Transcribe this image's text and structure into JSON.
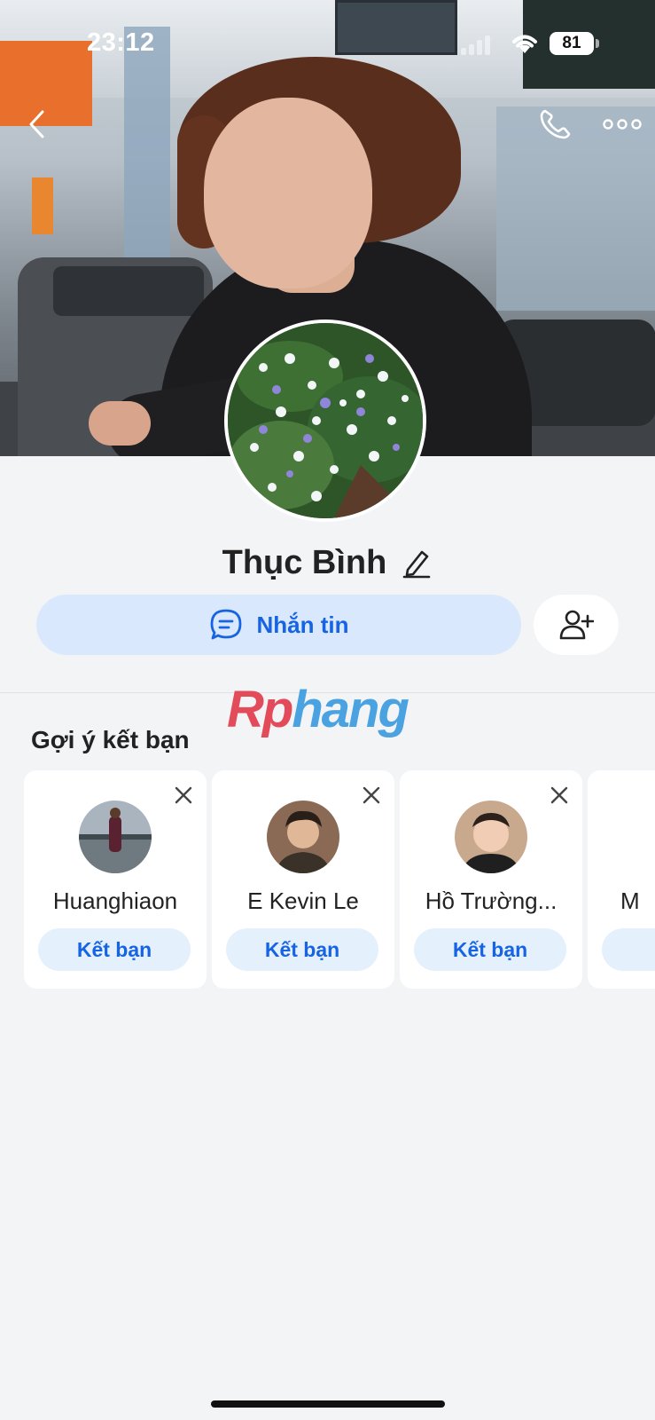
{
  "status_bar": {
    "time": "23:12",
    "battery": "81"
  },
  "profile": {
    "name": "Thục Bình"
  },
  "actions": {
    "message_label": "Nhắn tin"
  },
  "watermark": {
    "part_a": "Rp",
    "part_b": "hang"
  },
  "suggestions": {
    "title": "Gợi ý kết bạn",
    "add_label": "Kết bạn",
    "items": [
      {
        "name": "Huanghiaon"
      },
      {
        "name": "E Kevin Le"
      },
      {
        "name": "Hồ Trường..."
      },
      {
        "name": "M"
      }
    ]
  },
  "icons": {
    "back": "chevron-left-icon",
    "call": "phone-icon",
    "more": "more-horizontal-icon",
    "edit": "pencil-icon",
    "message": "chat-bubble-icon",
    "add_friend": "user-plus-icon",
    "dismiss": "close-icon"
  },
  "colors": {
    "accent": "#1764e3",
    "accent_bg": "#d9e8fc",
    "page_bg": "#f3f4f6"
  }
}
